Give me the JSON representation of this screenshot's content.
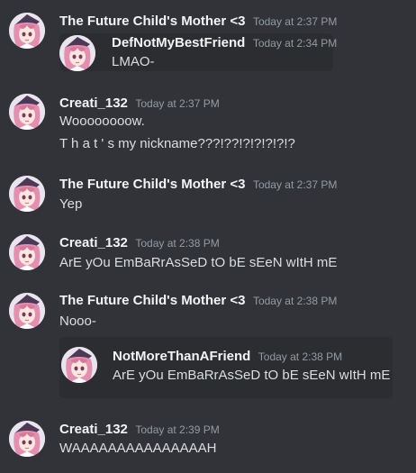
{
  "messages": [
    {
      "author": "The Future Child's Mother <3",
      "timestamp": "Today at 2:37 PM",
      "embed": {
        "author": "DefNotMyBestFriend",
        "timestamp": "Today at 2:34 PM",
        "text": "LMAO-"
      }
    },
    {
      "author": "Creati_132",
      "timestamp": "Today at 2:37 PM",
      "lines": [
        "Woooooooow.",
        "T h a t ' s my nickname???!??!?!?!?!?!?"
      ]
    },
    {
      "author": "The Future Child's Mother <3",
      "timestamp": "Today at 2:37 PM",
      "lines": [
        "Yep"
      ]
    },
    {
      "author": "Creati_132",
      "timestamp": "Today at 2:38 PM",
      "lines": [
        "ArE yOu EmBaRrAsSeD tO bE sEeN wItH mE"
      ]
    },
    {
      "author": "The Future Child's Mother <3",
      "timestamp": "Today at 2:38 PM",
      "lines": [
        "Nooo-"
      ],
      "embed": {
        "author": "NotMoreThanAFriend",
        "timestamp": "Today at 2:38 PM",
        "text": "ArE yOu EmBaRrAsSeD tO bE sEeN wItH mE"
      }
    },
    {
      "author": "Creati_132",
      "timestamp": "Today at 2:39 PM",
      "lines": [
        "WAAAAAAAAAAAAAAAH"
      ]
    }
  ]
}
